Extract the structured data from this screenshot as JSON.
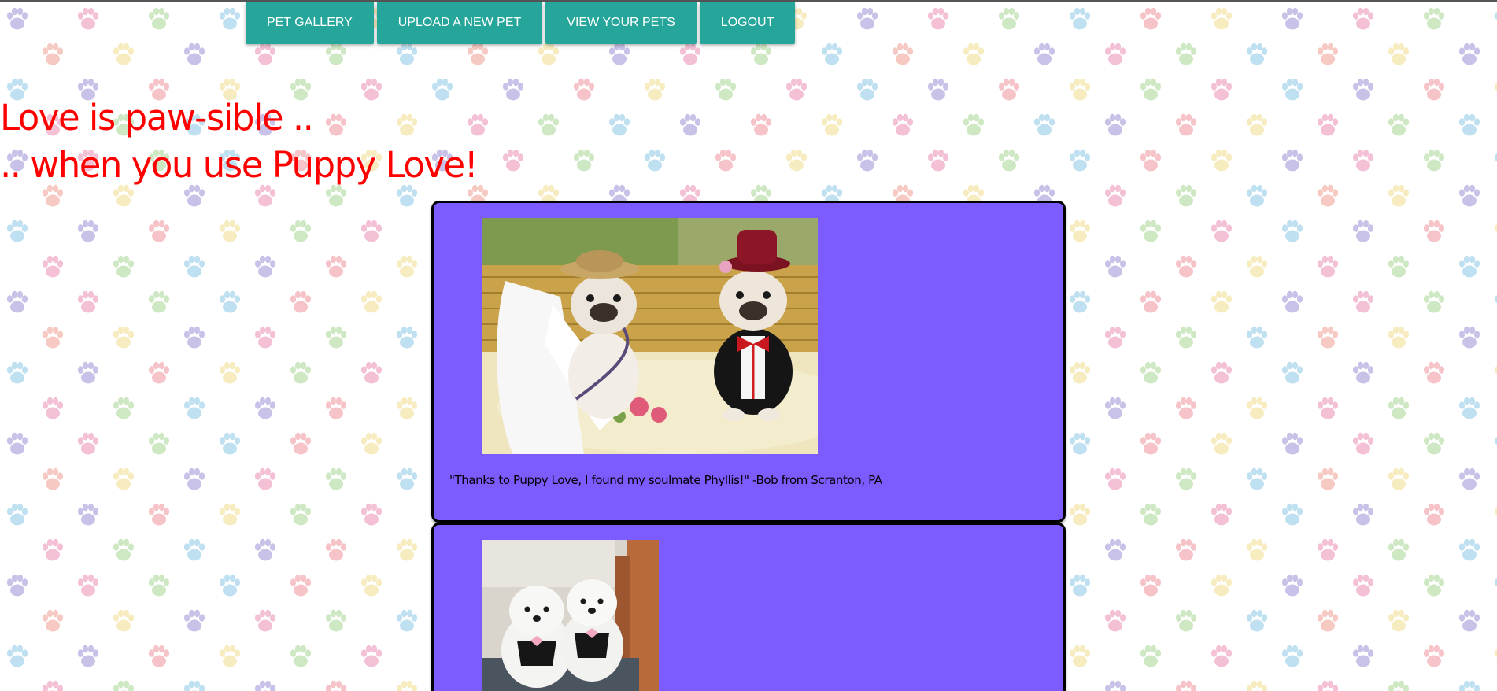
{
  "nav": {
    "items": [
      {
        "label": "PET GALLERY"
      },
      {
        "label": "UPLOAD A NEW PET"
      },
      {
        "label": "VIEW YOUR PETS"
      },
      {
        "label": "LOGOUT"
      }
    ]
  },
  "hero": {
    "line1": "Love is paw-sible ..",
    "line2": ".. when you use Puppy Love!"
  },
  "testimonials": [
    {
      "caption": "\"Thanks to Puppy Love, I found my soulmate Phyllis!\" -Bob from Scranton, PA"
    },
    {
      "caption": ""
    }
  ],
  "colors": {
    "nav_button": "#26a69a",
    "hero_text": "#ff0000",
    "card_bg": "#7c5cff"
  }
}
